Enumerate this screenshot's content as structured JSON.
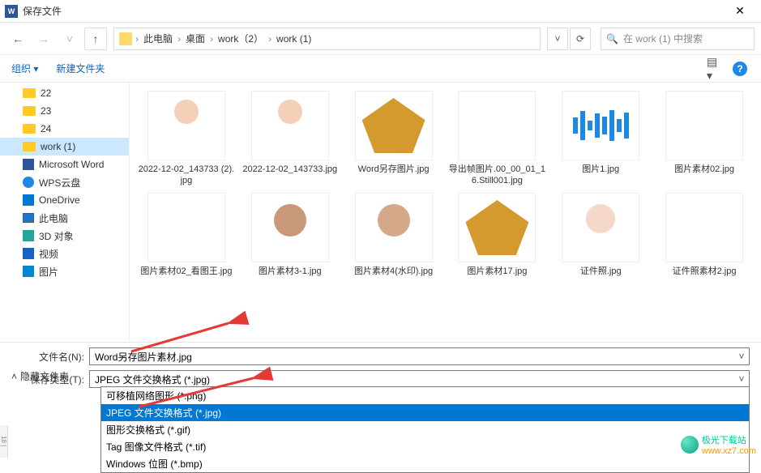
{
  "titlebar": {
    "title": "保存文件"
  },
  "nav": {
    "breadcrumb": [
      "此电脑",
      "桌面",
      "work（2）",
      "work (1)"
    ],
    "search_placeholder": "在 work (1) 中搜索"
  },
  "toolbar": {
    "organize": "组织 ▾",
    "newfolder": "新建文件夹"
  },
  "sidebar": {
    "items": [
      {
        "label": "22",
        "type": "folder"
      },
      {
        "label": "23",
        "type": "folder"
      },
      {
        "label": "24",
        "type": "folder"
      },
      {
        "label": "work (1)",
        "type": "folder",
        "selected": true
      },
      {
        "label": "Microsoft Word",
        "type": "word"
      },
      {
        "label": "WPS云盘",
        "type": "wps"
      },
      {
        "label": "OneDrive",
        "type": "od"
      },
      {
        "label": "此电脑",
        "type": "pc"
      },
      {
        "label": "3D 对象",
        "type": "obj"
      },
      {
        "label": "视频",
        "type": "vid"
      },
      {
        "label": "图片",
        "type": "pic"
      }
    ]
  },
  "files_row1": [
    {
      "name": "2022-12-02_143733 (2).jpg",
      "thumb": "person1"
    },
    {
      "name": "2022-12-02_143733.jpg",
      "thumb": "person1"
    },
    {
      "name": "Word另存图片.jpg",
      "thumb": "leaf"
    },
    {
      "name": "导出帧图片.00_00_01_16.Still001.jpg",
      "thumb": "city"
    },
    {
      "name": "图片1.jpg",
      "thumb": "chart"
    },
    {
      "name": "图片素材02.jpg",
      "thumb": "beach"
    }
  ],
  "files_row2": [
    {
      "name": "图片素材02_看图王.jpg",
      "thumb": "beach"
    },
    {
      "name": "图片素材3-1.jpg",
      "thumb": "oldman"
    },
    {
      "name": "图片素材4(水印).jpg",
      "thumb": "oldwoman"
    },
    {
      "name": "图片素材17.jpg",
      "thumb": "leaf"
    },
    {
      "name": "证件照.jpg",
      "thumb": "idphoto"
    },
    {
      "name": "证件照素材2.jpg",
      "thumb": "idgrid"
    }
  ],
  "filename_label": "文件名(N):",
  "filename_value": "Word另存图片素材.jpg",
  "filetype_label": "保存类型(T):",
  "filetype_value": "JPEG 文件交换格式 (*.jpg)",
  "filetype_options": [
    {
      "label": "可移植网络图形 (*.png)"
    },
    {
      "label": "JPEG 文件交换格式 (*.jpg)",
      "hl": true
    },
    {
      "label": "图形交换格式 (*.gif)"
    },
    {
      "label": "Tag 图像文件格式 (*.tif)"
    },
    {
      "label": "Windows 位图 (*.bmp)"
    }
  ],
  "hide_folders": "隐藏文件夹",
  "watermark": {
    "brand": "极光下载站",
    "url": "www.xz7.com"
  },
  "leftbar": "18 |"
}
